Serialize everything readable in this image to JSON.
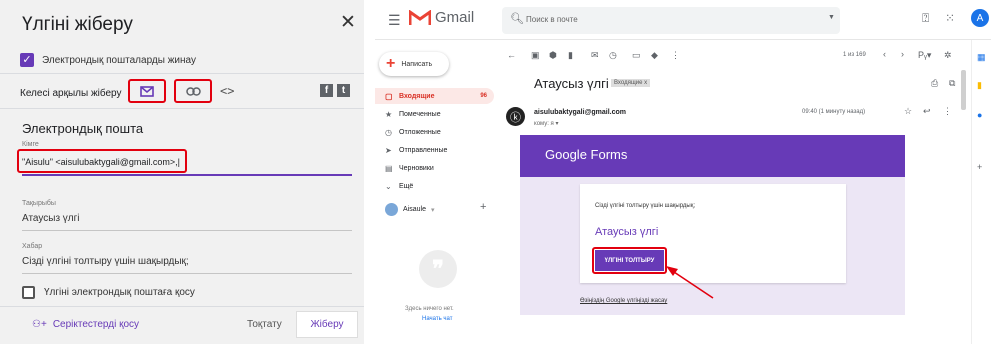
{
  "dialog": {
    "title": "Үлгіні жіберу",
    "close": "✕",
    "collect_label": "Электрондық пошталарды жинау",
    "send_via_label": "Келесі арқылы жіберу",
    "section_title": "Электрондық пошта",
    "to_label": "Кімге",
    "to_value": "\"Aisulu\" <aisulubaktygali@gmail.com>,|",
    "subject_label": "Тақырыбы",
    "subject_value": "Атаусыз үлгі",
    "message_label": "Хабар",
    "message_value": "Сізді үлгіні толтыру үшін шақырдық;",
    "include_label": "Үлгіні электрондық поштаға қосу",
    "collaborators_label": "Серіктестерді қосу",
    "cancel_label": "Тоқтату",
    "send_label": "Жіберу"
  },
  "gmail": {
    "logo_text": "Gmail",
    "search_placeholder": "Поиск в почте",
    "compose_label": "Написать",
    "nav": [
      {
        "label": "Входящие",
        "count": "96",
        "icon": "inbox-icon"
      },
      {
        "label": "Помеченные",
        "icon": "star-icon"
      },
      {
        "label": "Отложенные",
        "icon": "clock-icon"
      },
      {
        "label": "Отправленные",
        "icon": "send-icon"
      },
      {
        "label": "Черновики",
        "icon": "draft-icon"
      },
      {
        "label": "Ещё",
        "icon": "chevron-down-icon"
      }
    ],
    "chat_user": "Aisaule",
    "empty_chat": "Здесь ничего нет.",
    "start_chat": "Начать чат",
    "pager": "1 из 169",
    "subject": "Атаусыз үлгі",
    "inbox_tag": "Входящие x",
    "sender": "aisulubaktygali@gmail.com",
    "to_me": "кому: я ▾",
    "time": "09:40 (1 минуту назад)",
    "avatar_letter": "A",
    "form": {
      "logo": "Google Forms",
      "invite_text": "Сізді үлгіні толтыру үшін шақырдық;",
      "form_title": "Атаусыз үлгі",
      "fill_button": "ҮЛГІНІ ТОЛТЫРУ",
      "own_link": "Өзіңіздің Google үлгіңізді жасау"
    }
  }
}
